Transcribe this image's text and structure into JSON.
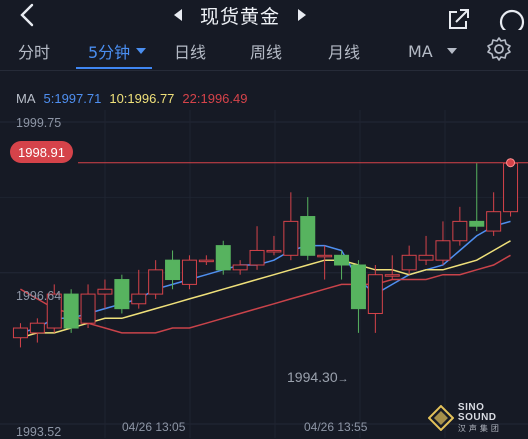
{
  "header": {
    "title": "现货黄金"
  },
  "tabs": [
    {
      "label": "分时",
      "active": false,
      "dropdown": false
    },
    {
      "label": "5分钟",
      "active": true,
      "dropdown": true
    },
    {
      "label": "日线",
      "active": false,
      "dropdown": false
    },
    {
      "label": "周线",
      "active": false,
      "dropdown": false
    },
    {
      "label": "月线",
      "active": false,
      "dropdown": false
    },
    {
      "label": "MA",
      "active": false,
      "dropdown": true
    }
  ],
  "ma_legend": {
    "title": "MA",
    "ma5": "5:1997.71",
    "ma10": "10:1996.77",
    "ma22": "22:1996.49"
  },
  "price_tag": "1998.91",
  "colors": {
    "up": "#d5434a",
    "down": "#57b35f",
    "ma5": "#4f8ff0",
    "ma10": "#efe07a",
    "ma22": "#c9434a",
    "background": "#161a25",
    "accent": "#3f86f2"
  },
  "chart_data": {
    "type": "candlestick",
    "y_ticks": [
      "1999.75",
      "1996.64",
      "1993.52"
    ],
    "ylim": [
      1993.52,
      1999.75
    ],
    "x_ticks": [
      "04/26 13:05",
      "04/26 13:55"
    ],
    "last_price": 1998.91,
    "low_annotation": "1994.30",
    "candles": [
      {
        "o": 1995.3,
        "c": 1995.5,
        "h": 1995.6,
        "l": 1995.1
      },
      {
        "o": 1995.4,
        "c": 1995.6,
        "h": 1995.7,
        "l": 1995.2
      },
      {
        "o": 1995.5,
        "c": 1996.2,
        "h": 1996.4,
        "l": 1995.4
      },
      {
        "o": 1996.2,
        "c": 1995.5,
        "h": 1996.3,
        "l": 1995.4
      },
      {
        "o": 1995.6,
        "c": 1996.2,
        "h": 1996.4,
        "l": 1995.5
      },
      {
        "o": 1996.2,
        "c": 1996.3,
        "h": 1996.5,
        "l": 1995.9
      },
      {
        "o": 1996.5,
        "c": 1995.9,
        "h": 1996.6,
        "l": 1995.8
      },
      {
        "o": 1996.0,
        "c": 1996.2,
        "h": 1996.7,
        "l": 1995.9
      },
      {
        "o": 1996.2,
        "c": 1996.7,
        "h": 1996.9,
        "l": 1996.1
      },
      {
        "o": 1996.9,
        "c": 1996.5,
        "h": 1997.1,
        "l": 1996.3
      },
      {
        "o": 1996.4,
        "c": 1996.9,
        "h": 1997.0,
        "l": 1996.3
      },
      {
        "o": 1996.9,
        "c": 1996.9,
        "h": 1997.0,
        "l": 1996.8
      },
      {
        "o": 1997.2,
        "c": 1996.7,
        "h": 1997.3,
        "l": 1996.6
      },
      {
        "o": 1996.7,
        "c": 1996.8,
        "h": 1996.9,
        "l": 1996.6
      },
      {
        "o": 1996.8,
        "c": 1997.1,
        "h": 1997.6,
        "l": 1996.7
      },
      {
        "o": 1997.1,
        "c": 1997.1,
        "h": 1997.4,
        "l": 1997.0
      },
      {
        "o": 1997.0,
        "c": 1997.7,
        "h": 1998.3,
        "l": 1996.9
      },
      {
        "o": 1997.8,
        "c": 1997.0,
        "h": 1998.2,
        "l": 1996.9
      },
      {
        "o": 1997.0,
        "c": 1997.0,
        "h": 1997.2,
        "l": 1996.5
      },
      {
        "o": 1997.0,
        "c": 1996.8,
        "h": 1997.1,
        "l": 1996.5
      },
      {
        "o": 1996.8,
        "c": 1995.9,
        "h": 1996.9,
        "l": 1995.4
      },
      {
        "o": 1995.8,
        "c": 1996.6,
        "h": 1996.8,
        "l": 1995.4
      },
      {
        "o": 1996.6,
        "c": 1996.6,
        "h": 1997.0,
        "l": 1996.5
      },
      {
        "o": 1996.7,
        "c": 1997.0,
        "h": 1997.2,
        "l": 1996.6
      },
      {
        "o": 1996.9,
        "c": 1997.0,
        "h": 1997.4,
        "l": 1996.8
      },
      {
        "o": 1996.9,
        "c": 1997.3,
        "h": 1997.7,
        "l": 1996.8
      },
      {
        "o": 1997.3,
        "c": 1997.7,
        "h": 1998.0,
        "l": 1997.2
      },
      {
        "o": 1997.7,
        "c": 1997.6,
        "h": 1998.9,
        "l": 1997.5
      },
      {
        "o": 1997.5,
        "c": 1997.9,
        "h": 1998.3,
        "l": 1997.4
      },
      {
        "o": 1997.9,
        "c": 1998.9,
        "h": 1999.0,
        "l": 1997.8
      }
    ],
    "series": [
      {
        "name": "MA5",
        "values": [
          1995.4,
          1995.5,
          1995.7,
          1995.7,
          1995.8,
          1995.9,
          1996.0,
          1996.1,
          1996.3,
          1996.4,
          1996.5,
          1996.6,
          1996.7,
          1996.8,
          1996.8,
          1996.9,
          1997.1,
          1997.2,
          1997.2,
          1997.1,
          1996.5,
          1996.2,
          1996.4,
          1996.6,
          1996.7,
          1996.8,
          1997.1,
          1997.4,
          1997.6,
          1997.7
        ]
      },
      {
        "name": "MA10",
        "values": [
          1995.3,
          1995.4,
          1995.4,
          1995.5,
          1995.6,
          1995.7,
          1995.7,
          1995.8,
          1995.9,
          1996.0,
          1996.1,
          1996.2,
          1996.3,
          1996.4,
          1996.5,
          1996.6,
          1996.7,
          1996.8,
          1996.9,
          1996.9,
          1996.8,
          1996.7,
          1996.7,
          1996.6,
          1996.7,
          1996.7,
          1996.8,
          1996.9,
          1997.1,
          1997.3
        ]
      },
      {
        "name": "MA22",
        "values": [
          1996.3,
          1996.1,
          1995.9,
          1995.8,
          1995.6,
          1995.5,
          1995.4,
          1995.4,
          1995.4,
          1995.5,
          1995.5,
          1995.6,
          1995.7,
          1995.8,
          1995.9,
          1996.0,
          1996.1,
          1996.2,
          1996.3,
          1996.4,
          1996.4,
          1996.4,
          1996.5,
          1996.5,
          1996.5,
          1996.6,
          1996.6,
          1996.7,
          1996.8,
          1997.0
        ]
      }
    ],
    "grid": true
  },
  "logo": {
    "name": "SINO SOUND",
    "sub": "汉声集团"
  }
}
